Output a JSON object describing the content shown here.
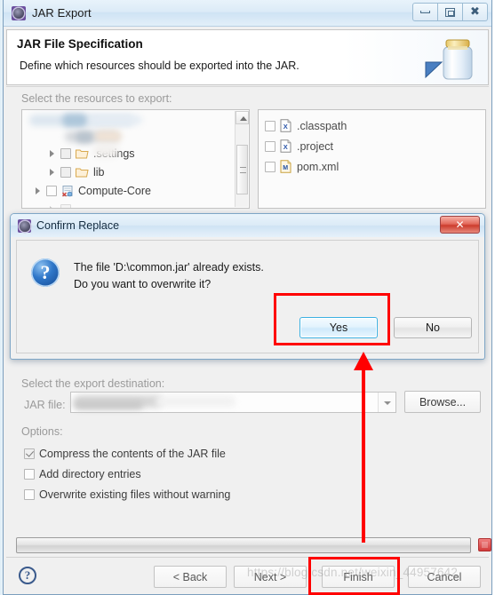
{
  "window": {
    "title": "JAR Export",
    "icon": "jar-export-icon",
    "controls": {
      "minimize": "minimize-icon",
      "maximize": "maximize-icon",
      "close": "close-icon"
    }
  },
  "header": {
    "title": "JAR File Specification",
    "subtitle": "Define which resources should be exported into the JAR.",
    "art": "jar-jar-icon"
  },
  "resources": {
    "section_label": "Select the resources to export:",
    "tree": [
      {
        "label": "",
        "blurred": true,
        "checkbox": "unchecked",
        "icon": "project-icon",
        "indent": 0
      },
      {
        "label": "",
        "blurred": true,
        "checkbox": "unchecked",
        "icon": "folder-icon",
        "indent": 1
      },
      {
        "label": ".settings",
        "blurred": false,
        "checkbox": "unchecked",
        "icon": "folder-icon",
        "indent": 1
      },
      {
        "label": "lib",
        "blurred": false,
        "checkbox": "unchecked",
        "icon": "folder-icon",
        "indent": 1
      },
      {
        "label": "Compute-Core",
        "blurred": false,
        "checkbox": "unchecked",
        "icon": "project-icon",
        "indent": 0
      }
    ],
    "files": [
      {
        "label": ".classpath",
        "checkbox": "unchecked",
        "icon": "xml-file-icon"
      },
      {
        "label": ".project",
        "checkbox": "unchecked",
        "icon": "xml-file-icon"
      },
      {
        "label": "pom.xml",
        "checkbox": "unchecked",
        "icon": "maven-file-icon"
      }
    ]
  },
  "destination": {
    "section_label": "Select the export destination:",
    "jar_file_label": "JAR file:",
    "jar_file_value": "",
    "jar_file_blurred": true,
    "browse_label": "Browse..."
  },
  "options": {
    "section_label": "Options:",
    "items": [
      {
        "label": "Compress the contents of the JAR file",
        "checked": true,
        "enabled": false
      },
      {
        "label": "Add directory entries",
        "checked": false,
        "enabled": true
      },
      {
        "label": "Overwrite existing files without warning",
        "checked": false,
        "enabled": true
      }
    ]
  },
  "progress": {
    "value": 0,
    "stop_button": "stop-icon"
  },
  "footer": {
    "help": "?",
    "back_label": "< Back",
    "next_label": "Next >",
    "finish_label": "Finish",
    "cancel_label": "Cancel"
  },
  "confirm_dialog": {
    "title": "Confirm Replace",
    "icon": "jar-export-icon",
    "close_label": "✕",
    "question_icon": "?",
    "message_line1": "The file 'D:\\common.jar' already exists.",
    "message_line2": "Do you want to overwrite it?",
    "yes_label": "Yes",
    "no_label": "No"
  },
  "annotations": {
    "highlight_color": "#ff0000",
    "arrow_color": "#ff0000",
    "watermark": "https://blog.csdn.net/weixin_44957642"
  }
}
